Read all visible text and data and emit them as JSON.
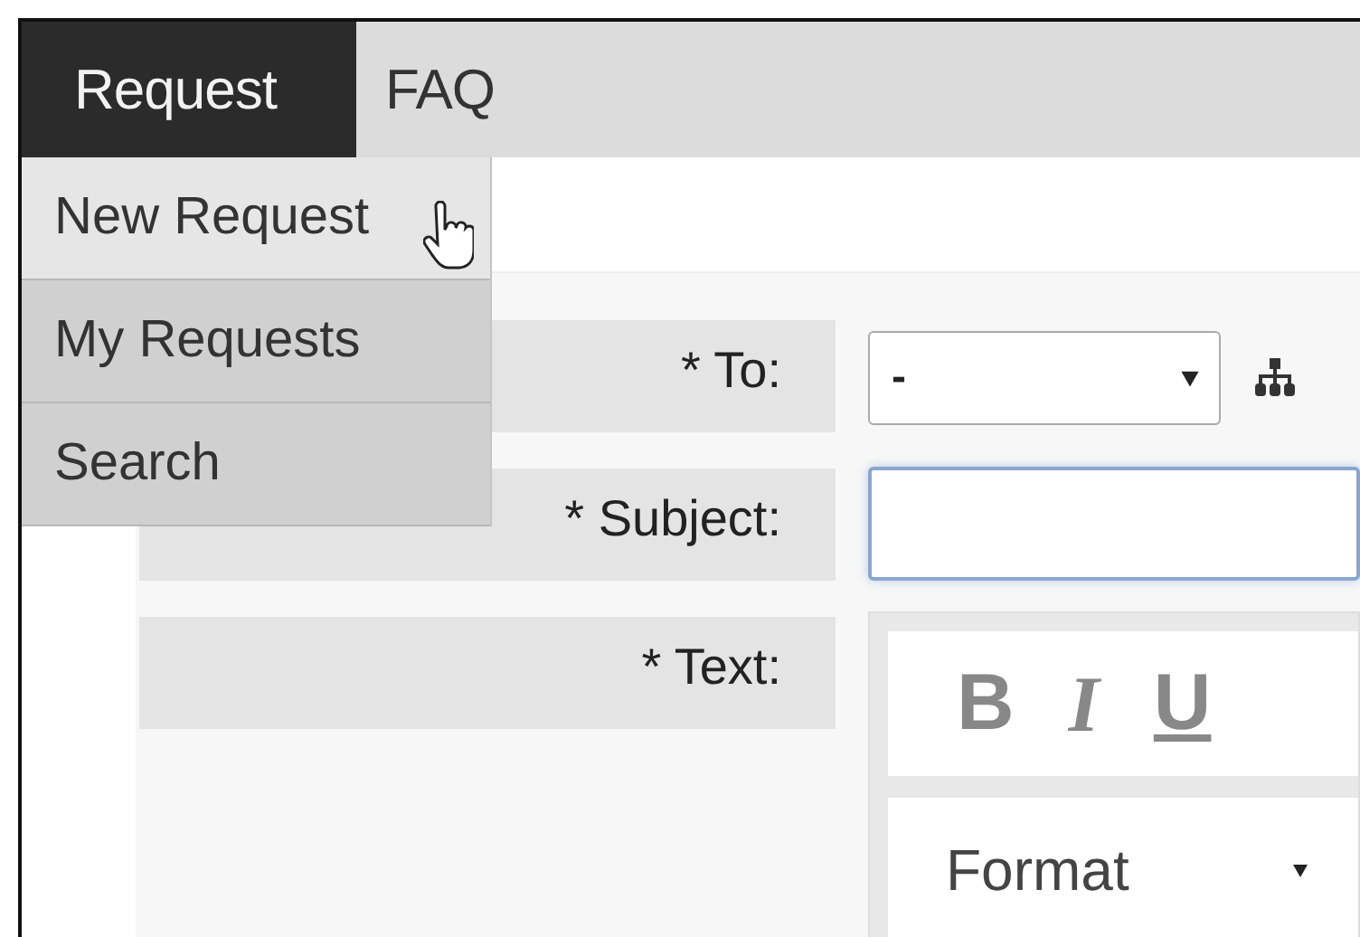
{
  "nav": {
    "tabs": [
      {
        "label": "Request",
        "selected": true
      },
      {
        "label": "FAQ",
        "selected": false
      }
    ]
  },
  "menu": {
    "items": [
      {
        "label": "New Request",
        "selected": true
      },
      {
        "label": "My Requests",
        "selected": false
      },
      {
        "label": "Search",
        "selected": false
      }
    ]
  },
  "form": {
    "fields": [
      {
        "kind": "select",
        "label": "* To:",
        "value": "-",
        "focused": false
      },
      {
        "kind": "text",
        "label": "* Subject:",
        "focused": true
      },
      {
        "kind": "editor",
        "label": "* Text:",
        "toolbar": [
          "B",
          "I",
          "U"
        ],
        "format": "Format",
        "focused": false
      }
    ]
  }
}
